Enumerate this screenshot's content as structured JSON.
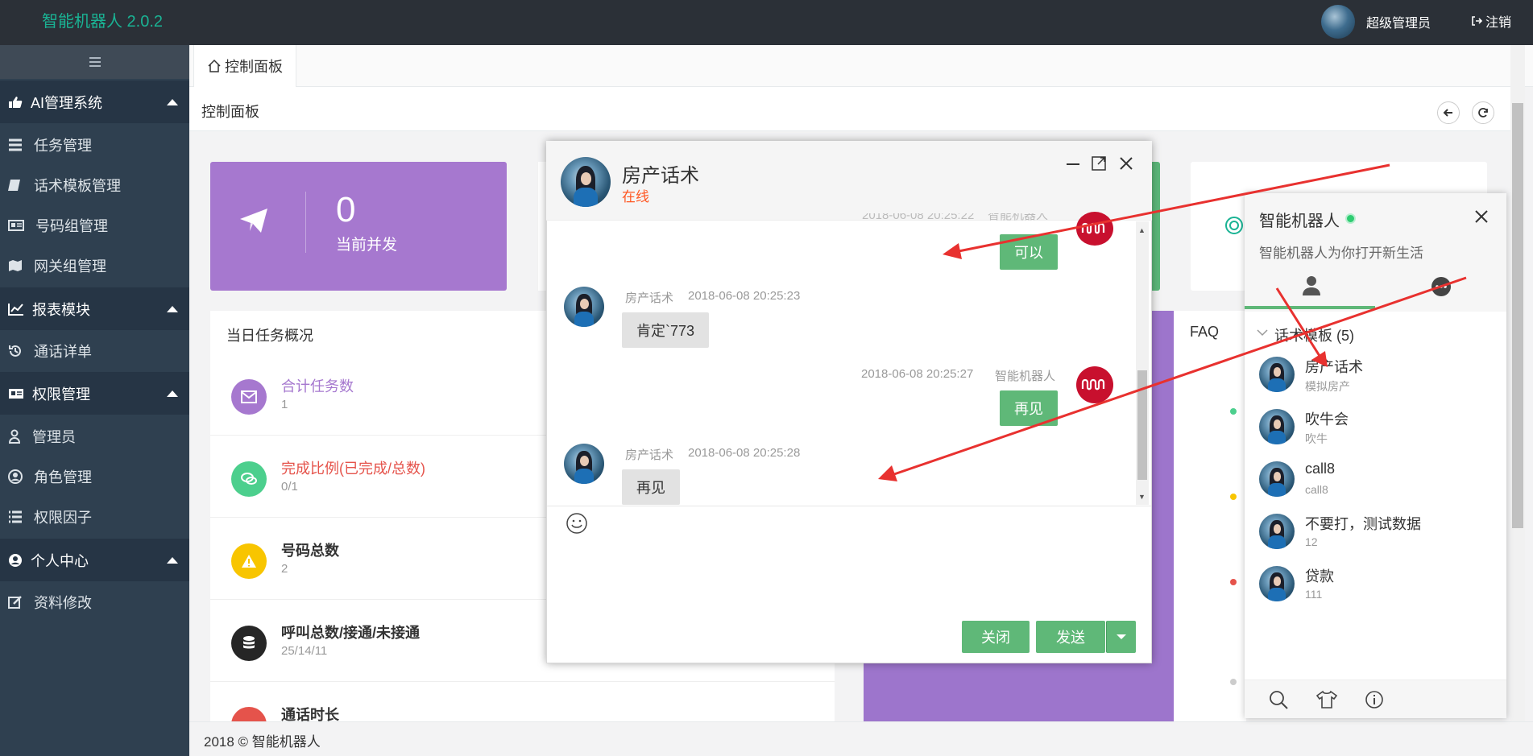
{
  "app": {
    "brand": "智能机器人 2.0.2",
    "user": "超级管理员",
    "logout": "注销"
  },
  "sidebar": {
    "groups": [
      {
        "label": "AI管理系统",
        "items": [
          "任务管理",
          "话术模板管理",
          "号码组管理",
          "网关组管理"
        ]
      },
      {
        "label": "报表模块",
        "items": [
          "通话详单"
        ]
      },
      {
        "label": "权限管理",
        "items": [
          "管理员",
          "角色管理",
          "权限因子"
        ]
      },
      {
        "label": "个人中心",
        "items": [
          "资料修改"
        ]
      }
    ]
  },
  "tabs": {
    "home": "控制面板"
  },
  "breadcrumb": "控制面板",
  "stats": {
    "concurrent_value": "0",
    "concurrent_label": "当前并发"
  },
  "task_overview": {
    "title": "当日任务概况",
    "rows": [
      {
        "name": "合计任务数",
        "value": "1",
        "color": "#a678cf"
      },
      {
        "name": "完成比例(已完成/总数)",
        "value": "0/1",
        "color": "#e5534b"
      },
      {
        "name": "号码总数",
        "value": "2",
        "color": "#333333"
      },
      {
        "name": "呼叫总数/接通/未接通",
        "value": "25/14/11",
        "color": "#333333"
      },
      {
        "name": "通话时长",
        "value": "",
        "color": "#333333"
      }
    ]
  },
  "faq": {
    "label": "FAQ"
  },
  "chat": {
    "title": "房产话术",
    "status": "在线",
    "messages": [
      {
        "dir": "out",
        "text": "可以"
      },
      {
        "dir": "in",
        "sender": "房产话术",
        "time": "2018-06-08 20:25:23",
        "text": "肯定`773"
      },
      {
        "dir": "out",
        "sender": "智能机器人",
        "time": "2018-06-08 20:25:27",
        "text": "再见"
      },
      {
        "dir": "in",
        "sender": "房产话术",
        "time": "2018-06-08 20:25:28",
        "text": "再见"
      }
    ],
    "close_label": "关闭",
    "send_label": "发送"
  },
  "contacts": {
    "name": "智能机器人",
    "signature": "智能机器人为你打开新生活",
    "group_label": "话术模板 (5)",
    "items": [
      {
        "name": "房产话术",
        "sub": "模拟房产"
      },
      {
        "name": "吹牛会",
        "sub": "吹牛"
      },
      {
        "name": "call8",
        "sub": "call8"
      },
      {
        "name": "不要打，测试数据",
        "sub": "12"
      },
      {
        "name": "贷款",
        "sub": "111"
      }
    ]
  },
  "footer": "2018 © 智能机器人",
  "colors": {
    "brand": "#1ab394",
    "sidebar": "#2f4050",
    "accent_green": "#5fb878",
    "purple": "#a678cf",
    "annotation": "#e8312f"
  }
}
